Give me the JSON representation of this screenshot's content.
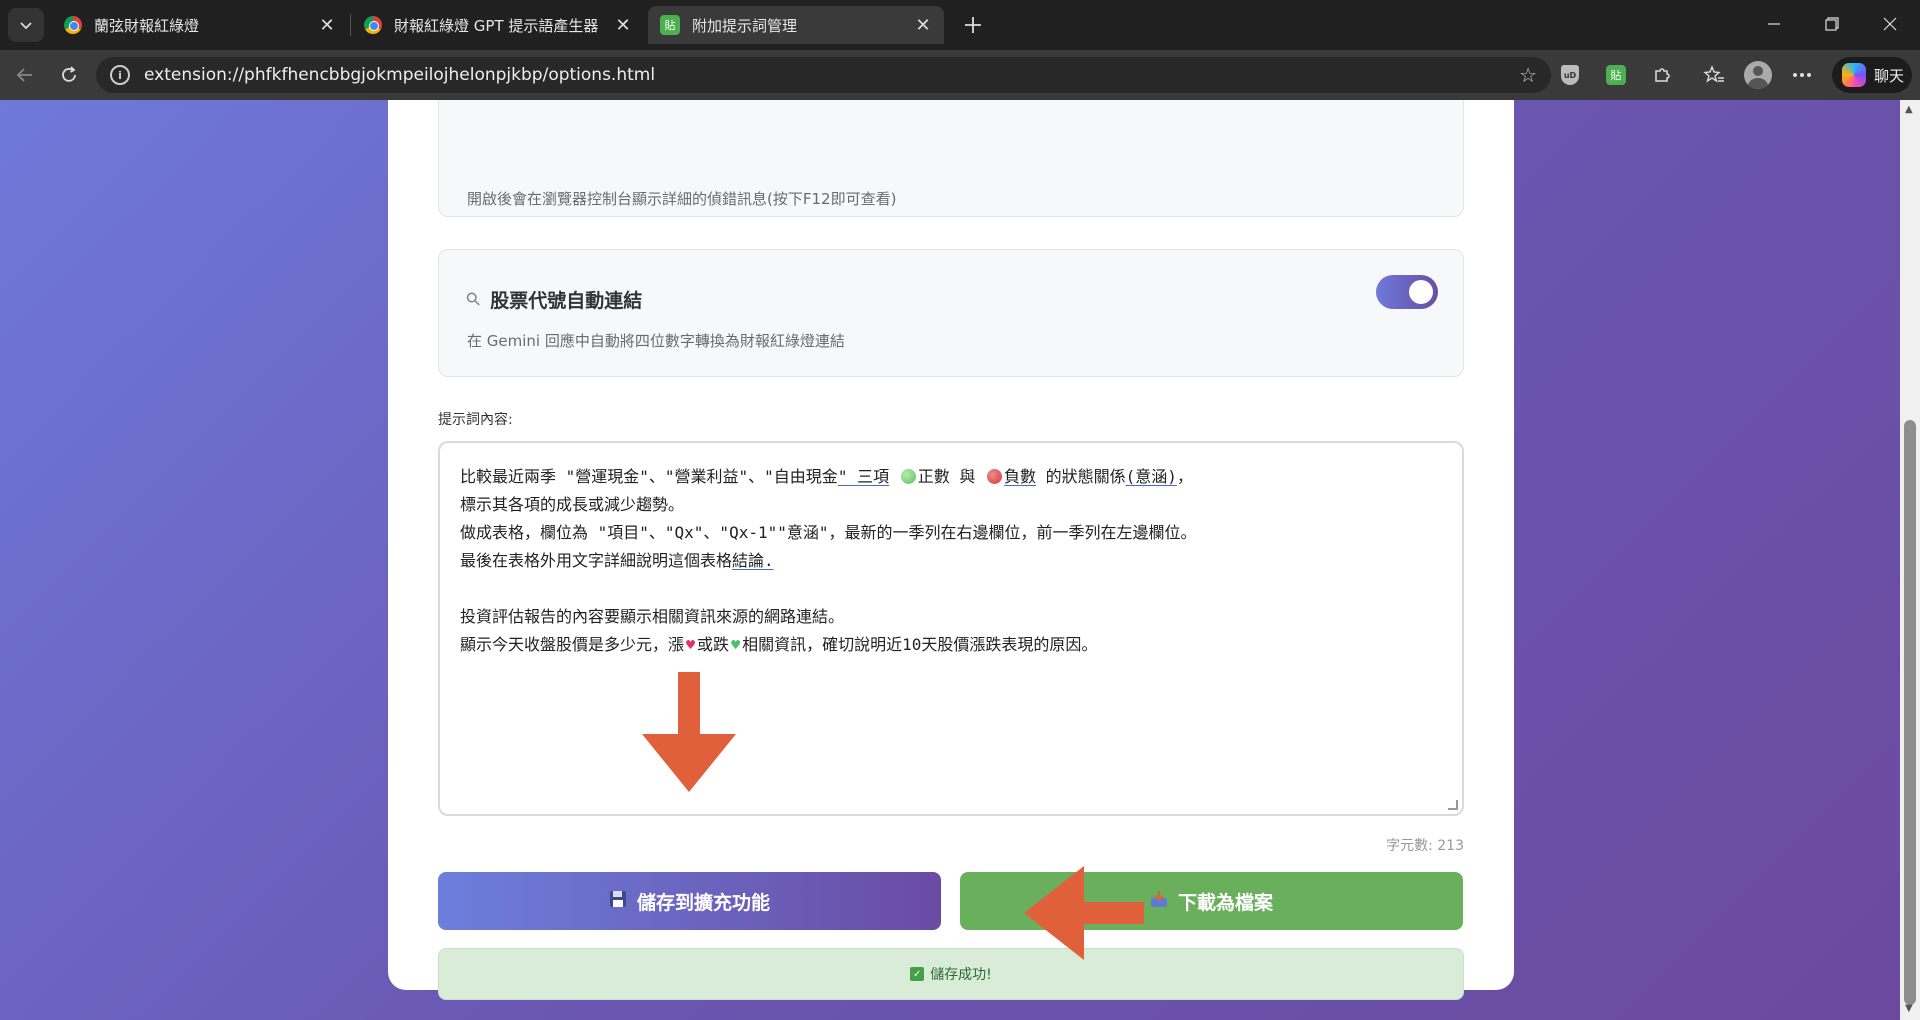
{
  "tabs": [
    {
      "title": "蘭弦財報紅綠燈",
      "favicon": "chrome-icon",
      "active": false
    },
    {
      "title": "財報紅綠燈 GPT 提示語產生器",
      "favicon": "chrome-icon",
      "active": false
    },
    {
      "title": "附加提示詞管理",
      "favicon": "paste-extension-icon",
      "active": true
    }
  ],
  "tab_close_glyph": "✕",
  "extension_label": "貼",
  "shield_label": "uD",
  "address_bar": {
    "url": "extension://phfkfhencbbgjokmpeilojhelonpjkbp/options.html"
  },
  "copilot_label": "聊天",
  "settings": {
    "debug": {
      "description": "開啟後會在瀏覽器控制台顯示詳細的偵錯訊息(按下F12即可查看)"
    },
    "auto_link": {
      "title": "股票代號自動連結",
      "description": "在 Gemini 回應中自動將四位數字轉換為財報紅綠燈連結",
      "enabled": true
    }
  },
  "prompt": {
    "label": "提示詞內容:",
    "lines": {
      "l1a": "比較最近兩季 \"營運現金\"、\"營業利益\"、\"自由現金",
      "l1b": "\" 三項",
      "l1c": "正數 與 ",
      "l1d": "負數",
      "l1e": " 的狀態關係",
      "l1f": "(意涵)",
      "l1g": "，",
      "l2": "標示其各項的成長或減少趨勢。",
      "l3": "做成表格，欄位為 \"項目\"、\"Qx\"、\"Qx-1\"\"意涵\"，最新的一季列在右邊欄位，前一季列在左邊欄位。",
      "l4a": "最後在表格外用文字詳細說明這個表格",
      "l4b": "結論.",
      "l5": "",
      "l6": "投資評估報告的內容要顯示相關資訊來源的網路連結。",
      "l7a": "顯示今天收盤股價是多少元，漲",
      "l7b": "或跌",
      "l7c": "相關資訊，確切說明近10天股價漲跌表現的原因。"
    },
    "char_count": "字元數: 213"
  },
  "buttons": {
    "save": "儲存到擴充功能",
    "download": "下載為檔案"
  },
  "status_message": "儲存成功!",
  "colors": {
    "accent_gradient_start": "#6e79d9",
    "accent_gradient_end": "#6a4da6",
    "download_green": "#6aaf5c",
    "annotation_arrow": "#e0603c",
    "success_bg": "#d8ecd8"
  }
}
